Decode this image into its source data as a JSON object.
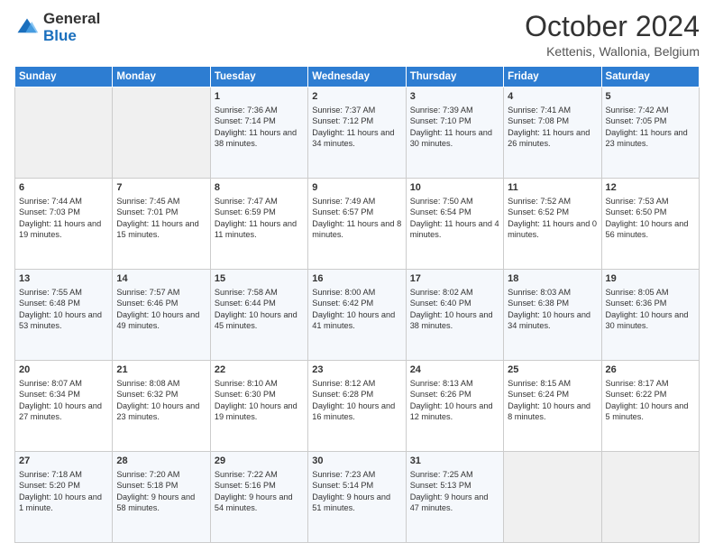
{
  "logo": {
    "general": "General",
    "blue": "Blue"
  },
  "header": {
    "month": "October 2024",
    "location": "Kettenis, Wallonia, Belgium"
  },
  "days": [
    "Sunday",
    "Monday",
    "Tuesday",
    "Wednesday",
    "Thursday",
    "Friday",
    "Saturday"
  ],
  "weeks": [
    [
      {
        "day": "",
        "empty": true
      },
      {
        "day": "",
        "empty": true
      },
      {
        "day": "1",
        "sunrise": "Sunrise: 7:36 AM",
        "sunset": "Sunset: 7:14 PM",
        "daylight": "Daylight: 11 hours and 38 minutes."
      },
      {
        "day": "2",
        "sunrise": "Sunrise: 7:37 AM",
        "sunset": "Sunset: 7:12 PM",
        "daylight": "Daylight: 11 hours and 34 minutes."
      },
      {
        "day": "3",
        "sunrise": "Sunrise: 7:39 AM",
        "sunset": "Sunset: 7:10 PM",
        "daylight": "Daylight: 11 hours and 30 minutes."
      },
      {
        "day": "4",
        "sunrise": "Sunrise: 7:41 AM",
        "sunset": "Sunset: 7:08 PM",
        "daylight": "Daylight: 11 hours and 26 minutes."
      },
      {
        "day": "5",
        "sunrise": "Sunrise: 7:42 AM",
        "sunset": "Sunset: 7:05 PM",
        "daylight": "Daylight: 11 hours and 23 minutes."
      }
    ],
    [
      {
        "day": "6",
        "sunrise": "Sunrise: 7:44 AM",
        "sunset": "Sunset: 7:03 PM",
        "daylight": "Daylight: 11 hours and 19 minutes."
      },
      {
        "day": "7",
        "sunrise": "Sunrise: 7:45 AM",
        "sunset": "Sunset: 7:01 PM",
        "daylight": "Daylight: 11 hours and 15 minutes."
      },
      {
        "day": "8",
        "sunrise": "Sunrise: 7:47 AM",
        "sunset": "Sunset: 6:59 PM",
        "daylight": "Daylight: 11 hours and 11 minutes."
      },
      {
        "day": "9",
        "sunrise": "Sunrise: 7:49 AM",
        "sunset": "Sunset: 6:57 PM",
        "daylight": "Daylight: 11 hours and 8 minutes."
      },
      {
        "day": "10",
        "sunrise": "Sunrise: 7:50 AM",
        "sunset": "Sunset: 6:54 PM",
        "daylight": "Daylight: 11 hours and 4 minutes."
      },
      {
        "day": "11",
        "sunrise": "Sunrise: 7:52 AM",
        "sunset": "Sunset: 6:52 PM",
        "daylight": "Daylight: 11 hours and 0 minutes."
      },
      {
        "day": "12",
        "sunrise": "Sunrise: 7:53 AM",
        "sunset": "Sunset: 6:50 PM",
        "daylight": "Daylight: 10 hours and 56 minutes."
      }
    ],
    [
      {
        "day": "13",
        "sunrise": "Sunrise: 7:55 AM",
        "sunset": "Sunset: 6:48 PM",
        "daylight": "Daylight: 10 hours and 53 minutes."
      },
      {
        "day": "14",
        "sunrise": "Sunrise: 7:57 AM",
        "sunset": "Sunset: 6:46 PM",
        "daylight": "Daylight: 10 hours and 49 minutes."
      },
      {
        "day": "15",
        "sunrise": "Sunrise: 7:58 AM",
        "sunset": "Sunset: 6:44 PM",
        "daylight": "Daylight: 10 hours and 45 minutes."
      },
      {
        "day": "16",
        "sunrise": "Sunrise: 8:00 AM",
        "sunset": "Sunset: 6:42 PM",
        "daylight": "Daylight: 10 hours and 41 minutes."
      },
      {
        "day": "17",
        "sunrise": "Sunrise: 8:02 AM",
        "sunset": "Sunset: 6:40 PM",
        "daylight": "Daylight: 10 hours and 38 minutes."
      },
      {
        "day": "18",
        "sunrise": "Sunrise: 8:03 AM",
        "sunset": "Sunset: 6:38 PM",
        "daylight": "Daylight: 10 hours and 34 minutes."
      },
      {
        "day": "19",
        "sunrise": "Sunrise: 8:05 AM",
        "sunset": "Sunset: 6:36 PM",
        "daylight": "Daylight: 10 hours and 30 minutes."
      }
    ],
    [
      {
        "day": "20",
        "sunrise": "Sunrise: 8:07 AM",
        "sunset": "Sunset: 6:34 PM",
        "daylight": "Daylight: 10 hours and 27 minutes."
      },
      {
        "day": "21",
        "sunrise": "Sunrise: 8:08 AM",
        "sunset": "Sunset: 6:32 PM",
        "daylight": "Daylight: 10 hours and 23 minutes."
      },
      {
        "day": "22",
        "sunrise": "Sunrise: 8:10 AM",
        "sunset": "Sunset: 6:30 PM",
        "daylight": "Daylight: 10 hours and 19 minutes."
      },
      {
        "day": "23",
        "sunrise": "Sunrise: 8:12 AM",
        "sunset": "Sunset: 6:28 PM",
        "daylight": "Daylight: 10 hours and 16 minutes."
      },
      {
        "day": "24",
        "sunrise": "Sunrise: 8:13 AM",
        "sunset": "Sunset: 6:26 PM",
        "daylight": "Daylight: 10 hours and 12 minutes."
      },
      {
        "day": "25",
        "sunrise": "Sunrise: 8:15 AM",
        "sunset": "Sunset: 6:24 PM",
        "daylight": "Daylight: 10 hours and 8 minutes."
      },
      {
        "day": "26",
        "sunrise": "Sunrise: 8:17 AM",
        "sunset": "Sunset: 6:22 PM",
        "daylight": "Daylight: 10 hours and 5 minutes."
      }
    ],
    [
      {
        "day": "27",
        "sunrise": "Sunrise: 7:18 AM",
        "sunset": "Sunset: 5:20 PM",
        "daylight": "Daylight: 10 hours and 1 minute."
      },
      {
        "day": "28",
        "sunrise": "Sunrise: 7:20 AM",
        "sunset": "Sunset: 5:18 PM",
        "daylight": "Daylight: 9 hours and 58 minutes."
      },
      {
        "day": "29",
        "sunrise": "Sunrise: 7:22 AM",
        "sunset": "Sunset: 5:16 PM",
        "daylight": "Daylight: 9 hours and 54 minutes."
      },
      {
        "day": "30",
        "sunrise": "Sunrise: 7:23 AM",
        "sunset": "Sunset: 5:14 PM",
        "daylight": "Daylight: 9 hours and 51 minutes."
      },
      {
        "day": "31",
        "sunrise": "Sunrise: 7:25 AM",
        "sunset": "Sunset: 5:13 PM",
        "daylight": "Daylight: 9 hours and 47 minutes."
      },
      {
        "day": "",
        "empty": true
      },
      {
        "day": "",
        "empty": true
      }
    ]
  ]
}
